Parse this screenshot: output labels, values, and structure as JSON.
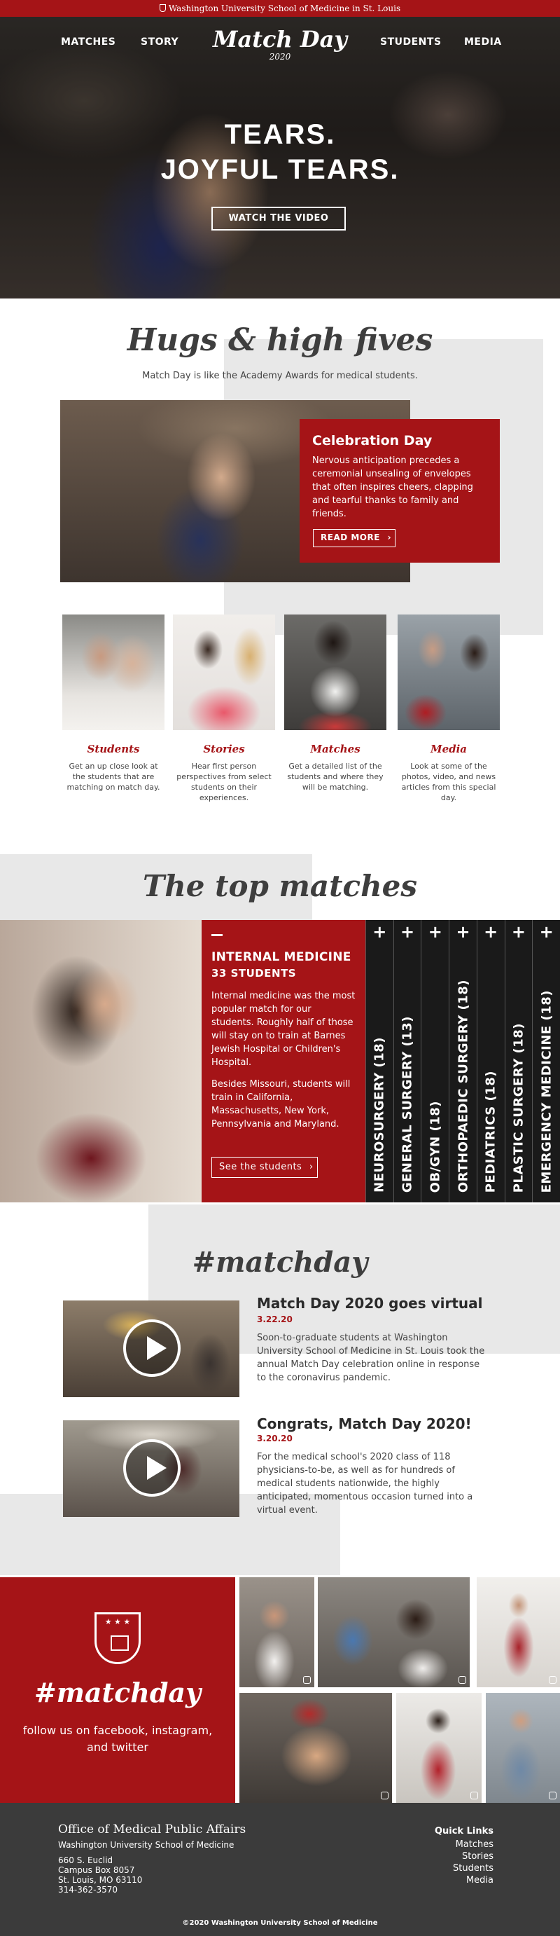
{
  "topbar": {
    "university": "Washington University School of Medicine in St. Louis"
  },
  "header": {
    "nav_left": [
      "MATCHES",
      "STORY"
    ],
    "nav_right": [
      "STUDENTS",
      "MEDIA"
    ],
    "brand_title": "Match Day",
    "brand_year": "2020"
  },
  "hero": {
    "line1": "TEARS.",
    "line2": "JOYFUL TEARS.",
    "button": "WATCH THE VIDEO"
  },
  "hugs": {
    "heading": "Hugs & high fives",
    "tagline": "Match Day is like the Academy Awards for medical students.",
    "card_title": "Celebration Day",
    "card_text": "Nervous anticipation precedes a ceremonial unsealing of envelopes that often inspires cheers, clapping and tearful thanks to family and friends.",
    "card_button": "READ MORE",
    "cards": [
      {
        "title": "Students",
        "desc": "Get an up close look at the students that are matching on match day."
      },
      {
        "title": "Stories",
        "desc": "Hear first person perspectives from select students on their experiences."
      },
      {
        "title": "Matches",
        "desc": "Get a detailed list of the students and where they will be matching."
      },
      {
        "title": "Media",
        "desc": "Look at some of the photos, video, and news articles from this special day."
      }
    ]
  },
  "top_matches": {
    "heading": "The top matches",
    "featured_title": "INTERNAL MEDICINE",
    "featured_count": "33 STUDENTS",
    "featured_p1": "Internal medicine was the most popular match for our students.  Roughly half of those will stay on to train at Barnes Jewish Hospital or Children's Hospital.",
    "featured_p2": "Besides Missouri, students will train in California, Massachusetts, New York, Pennsylvania and Maryland.",
    "featured_button": "See the students",
    "specialties": [
      "NEUROSURGERY (18)",
      "GENERAL SURGERY (13)",
      "OB/GYN (18)",
      "ORTHOPAEDIC SURGERY (18)",
      "PEDIATRICS (18)",
      "PLASTIC SURGERY (18)",
      "EMERGENCY MEDICINE (18)"
    ]
  },
  "news": {
    "heading": "#matchday",
    "items": [
      {
        "title": "Match Day 2020 goes virtual",
        "date": "3.22.20",
        "body": "Soon-to-graduate students at Washington University School of Medicine in St. Louis took the annual Match Day celebration online in response to the coronavirus pandemic."
      },
      {
        "title": "Congrats, Match Day 2020!",
        "date": "3.20.20",
        "body": "For the medical school's 2020 class of 118 physicians-to-be, as well as for hundreds of medical students nationwide, the highly anticipated, momentous occasion turned into a virtual event."
      }
    ]
  },
  "social": {
    "hashtag": "#matchday",
    "follow": "follow us on facebook, instagram, and twitter"
  },
  "footer": {
    "office": "Office of Medical Public Affairs",
    "school": "Washington University School of Medicine",
    "address": [
      "660 S. Euclid",
      "Campus Box 8057",
      "St. Louis, MO 63110",
      "314-362-3570"
    ],
    "quick_links_label": "Quick Links",
    "quick_links": [
      "Matches",
      "Stories",
      "Students",
      "Media"
    ],
    "copyright": "©2020 Washington University School of Medicine"
  },
  "colors": {
    "brand_red": "#a51417",
    "dark": "#1a1a1a",
    "footer_gray": "#3b3b3b",
    "light_gray": "#e8e8e8"
  }
}
